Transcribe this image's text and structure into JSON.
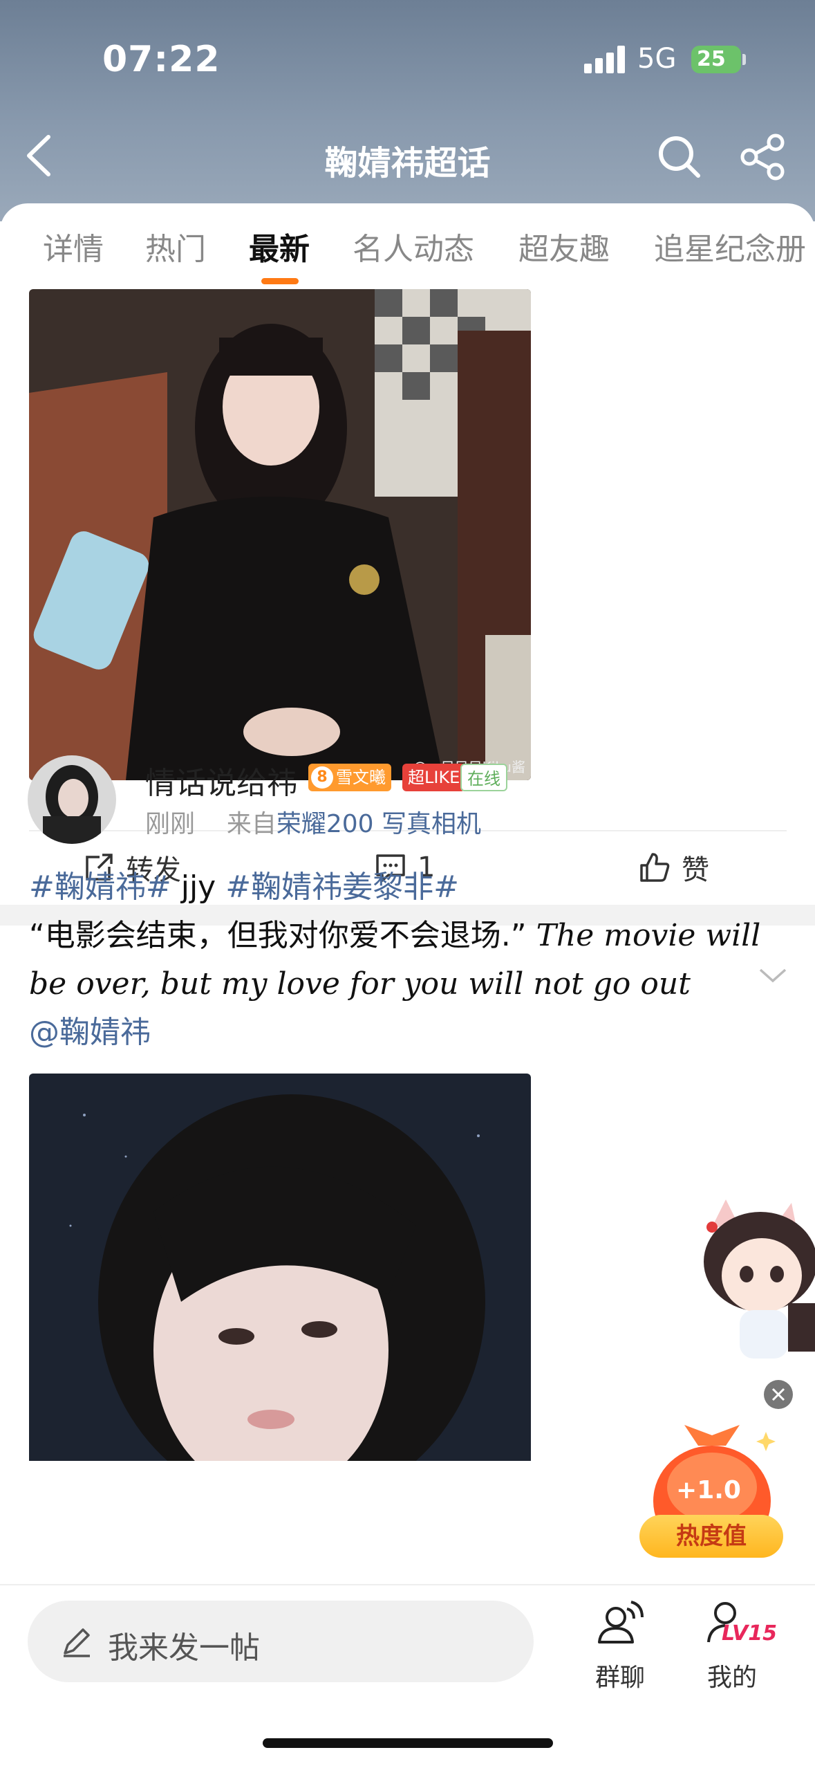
{
  "status_bar": {
    "time": "07:22",
    "network": "5G",
    "battery": "25"
  },
  "header": {
    "title": "鞠婧祎超话",
    "back_icon": "back-arrow-icon",
    "search_icon": "search-icon",
    "share_icon": "share-icon"
  },
  "tabs": [
    {
      "label": "详情"
    },
    {
      "label": "热门"
    },
    {
      "label": "最新",
      "active": true
    },
    {
      "label": "名人动态"
    },
    {
      "label": "超友趣"
    },
    {
      "label": "追星纪念册"
    }
  ],
  "post1": {
    "watermark": "@一只只只Kiku酱",
    "actions": {
      "repost": "转发",
      "comment_count": "1",
      "like": "赞"
    }
  },
  "post2": {
    "username": "情话说给祎",
    "badges": {
      "fan_level": "8",
      "fan_club": "雪文曦",
      "super_like": "超LIKE",
      "online": "在线"
    },
    "time": "刚刚",
    "source_prefix": "来自",
    "source": "荣耀200 写真相机",
    "text": {
      "tag1": "#鞠婧祎#",
      "t1": " jjy ",
      "tag2": "#鞠婧祎姜黎非#",
      "quote": "“电影会结束，但我对你爱不会退场.” ",
      "english": "The movie will be over, but my love for you will not go out",
      "mention": "@鞠婧祎"
    }
  },
  "float_widget": {
    "heat_value": "+1.0",
    "heat_label": "热度值"
  },
  "bottom_bar": {
    "composer_placeholder": "我来发一帖",
    "group_chat": "群聊",
    "mine": "我的",
    "level": "LV15"
  },
  "colors": {
    "accent": "#ff7a14",
    "link": "#4a6a9a",
    "header_bg": "#7f91a6"
  }
}
